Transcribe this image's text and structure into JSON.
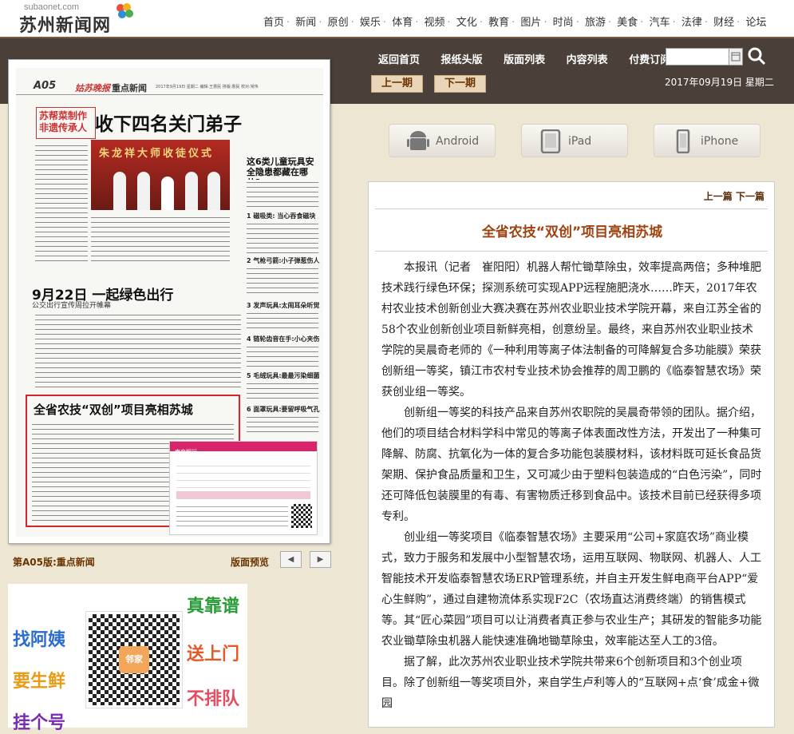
{
  "site": {
    "domain": "subaonet.com",
    "name": "苏州新闻网"
  },
  "topnav": [
    "首页",
    "新闻",
    "原创",
    "娱乐",
    "体育",
    "视频",
    "文化",
    "教育",
    "图片",
    "时尚",
    "旅游",
    "美食",
    "汽车",
    "法律",
    "财经",
    "论坛"
  ],
  "subnav": [
    "返回首页",
    "报纸头版",
    "版面列表",
    "内容列表",
    "付费订阅"
  ],
  "search": {
    "placeholder": ""
  },
  "issue_nav": {
    "prev": "上一期",
    "next": "下一期",
    "date": "2017年09月19日  星期二"
  },
  "newspaper": {
    "page": "A05",
    "brand": "姑苏晚报",
    "section": "重点新闻",
    "dateline": "2017年9月19日  星期二  编辑:王惠民  排版:惠民  校对:常伟",
    "tag": "苏帮菜制作非遗传承人",
    "headline": "收下四名关门弟子",
    "photo_banner": "朱龙祥大师收徒仪式",
    "side_title": "这6类儿童玩具安全隐患都藏在哪儿?",
    "side_items": [
      "1 磁吸类: 当心吞食磁块",
      "2 气枪弓箭:小子弹惹伤人",
      "3 发声玩具:太闹耳朵听觉",
      "4 链轮齿音在手:小心夹伤",
      "5 毛绒玩具:最最污染细菌",
      "6 面罩玩具:要留呼吸气孔"
    ],
    "mid_headline": "9月22日 一起绿色出行",
    "mid_sub": "公交出行宣传周拉开帷幕",
    "red_headline": "全省农技“双创”项目亮相苏城",
    "ad_brand": "南京银行"
  },
  "page_caption": "第A05版:重点新闻",
  "page_preview": "版面预览",
  "promo": {
    "left": [
      "找阿姨",
      "要生鲜",
      "挂个号"
    ],
    "right": [
      "真靠谱",
      "送上门",
      "不排队"
    ],
    "center": "邻家"
  },
  "apps": [
    "Android",
    "iPad",
    "iPhone"
  ],
  "article": {
    "prev": "上一篇",
    "next": "下一篇",
    "title": "全省农技“双创”项目亮相苏城",
    "paragraphs": [
      "本报讯（记者　崔阳阳）机器人帮忙锄草除虫，效率提高两倍；多种堆肥技术践行绿色环保；探测系统可实现APP远程施肥浇水……昨天，2017年农村农业技术创新创业大赛决赛在苏州农业职业技术学院开幕，来自江苏全省的58个农业创新创业项目新鲜亮相，创意纷呈。最终，来自苏州农业职业技术学院的吴晨奇老师的《一种利用等离子体法制备的可降解复合多功能膜》荣获创新组一等奖，镇江市农村专业技术协会推荐的周卫鹏的《临泰智慧农场》荣获创业组一等奖。",
      "创新组一等奖的科技产品来自苏州农职院的吴晨奇带领的团队。据介绍，他们的项目结合材料学科中常见的等离子体表面改性方法，开发出了一种集可降解、防腐、抗氧化为一体的复合多功能包装膜材料，该材料既可延长食品货架期、保护食品质量和卫生，又可减少由于塑料包装造成的“白色污染”，同时还可降低包装膜里的有毒、有害物质迁移到食品中。该技术目前已经获得多项专利。",
      "创业组一等奖项目《临泰智慧农场》主要采用“公司+家庭农场”商业模式，致力于服务和发展中小型智慧农场，运用互联网、物联网、机器人、人工智能技术开发临泰智慧农场ERP管理系统，并自主开发生鲜电商平台APP“爱心生鲜购”，通过自建物流体系实现F2C（农场直达消费终端）的销售模式等。其“匠心菜园”项目可以让消费者真正参与农业生产；其研发的智能多功能农业锄草除虫机器人能快速准确地锄草除虫，效率能达至人工的3倍。",
      "据了解，此次苏州农业职业技术学院共带来6个创新项目和3个创业项目。除了创新组一等奖项目外，来自学生卢利等人的“互联网+点‘食’成金+微园"
    ]
  },
  "colors": {
    "accent": "#a0420f",
    "dark_band": "#4a3f39",
    "background": "#ede6d3",
    "highlight": "#d2262b"
  }
}
